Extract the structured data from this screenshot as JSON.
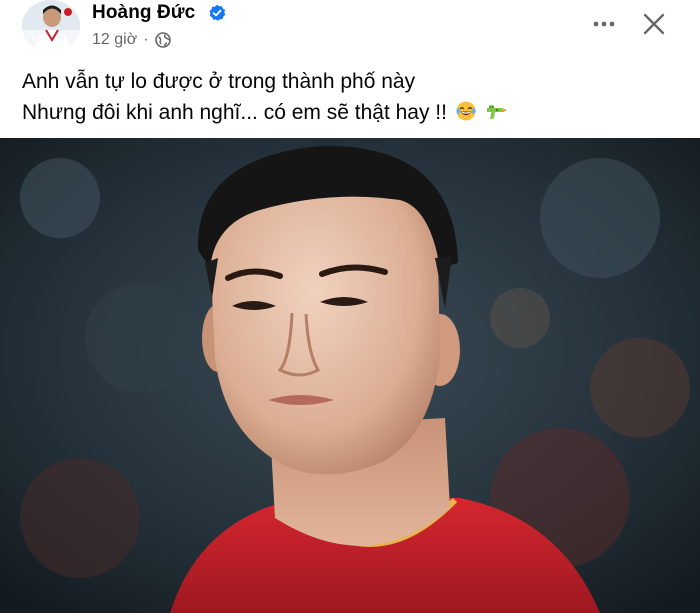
{
  "post": {
    "author": {
      "name": "Hoàng Đức",
      "verified": true,
      "avatar_icon": "profile-photo"
    },
    "timestamp": "12 giờ",
    "separator": "·",
    "audience_icon": "globe-icon",
    "actions": {
      "more_icon": "more-dots-icon",
      "close_icon": "close-icon"
    },
    "caption": {
      "line1": "Anh vẫn tự lo được ở trong thành phố này",
      "line2": "Nhưng đôi khi anh nghĩ... có em sẽ thật hay !!",
      "emojis": [
        "laughing-tears-emoji",
        "water-pistol-emoji"
      ]
    },
    "photo": {
      "subject": "player-portrait",
      "jersey_color": "#c8202a"
    }
  },
  "colors": {
    "text_primary": "#050505",
    "text_secondary": "#65676b",
    "verified_blue": "#1877f2"
  }
}
